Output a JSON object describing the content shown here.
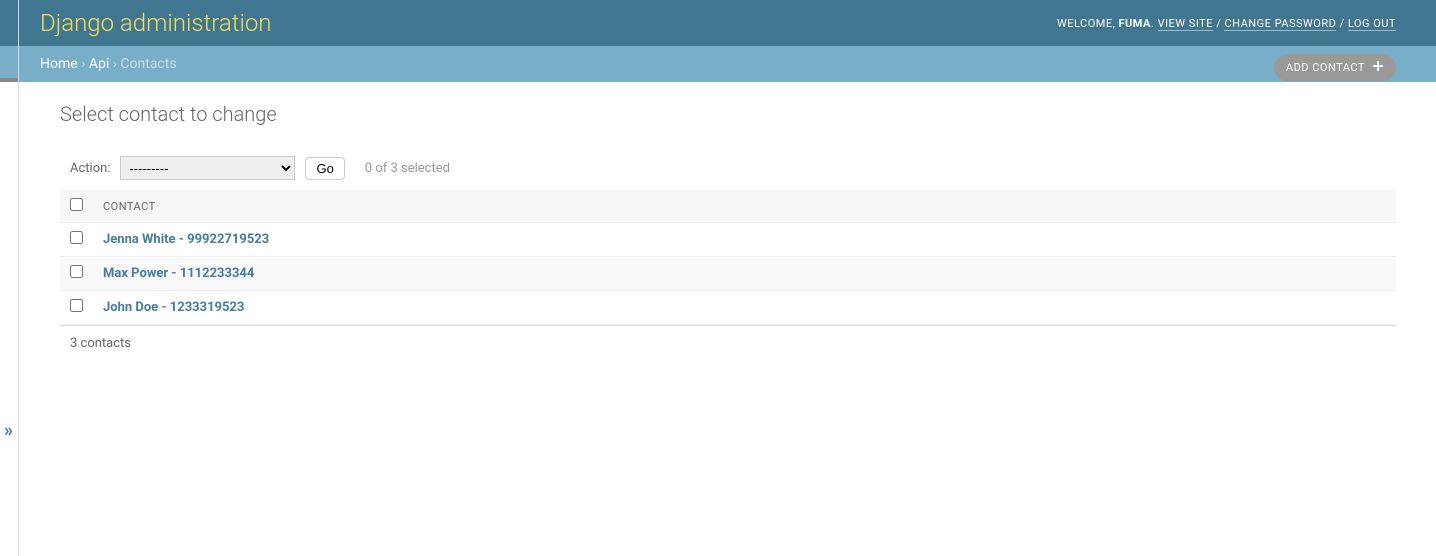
{
  "header": {
    "site_title": "Django administration",
    "welcome_prefix": "WELCOME, ",
    "username": "FUMA",
    "view_site": "VIEW SITE",
    "change_password": "CHANGE PASSWORD",
    "logout": "LOG OUT",
    "separator": " / "
  },
  "breadcrumbs": {
    "home": "Home",
    "app": "Api",
    "current": "Contacts",
    "sep": " › "
  },
  "page": {
    "title": "Select contact to change",
    "add_button": "ADD CONTACT"
  },
  "actions": {
    "label": "Action:",
    "default_option": "---------",
    "go_button": "Go",
    "counter": "0 of 3 selected"
  },
  "table": {
    "column_header": "CONTACT",
    "rows": [
      {
        "label": "Jenna White - 99922719523"
      },
      {
        "label": "Max Power - 1112233344"
      },
      {
        "label": "John Doe - 1233319523"
      }
    ]
  },
  "paginator": {
    "summary": "3 contacts"
  },
  "sidebar": {
    "toggle": "»"
  }
}
